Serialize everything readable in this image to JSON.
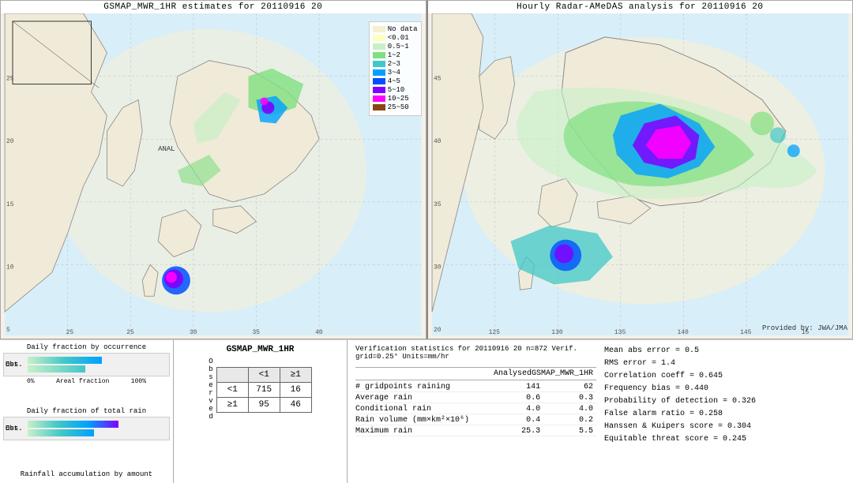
{
  "left_map": {
    "title": "GSMAP_MWR_1HR estimates for 20110916 20",
    "label_anal": "ANAL"
  },
  "right_map": {
    "title": "Hourly Radar-AMeDAS analysis for 20110916 20",
    "provided_by": "Provided by: JWA/JMA"
  },
  "legend": {
    "title": "",
    "items": [
      {
        "label": "No data",
        "color": "#f5f0d0"
      },
      {
        "label": "<0.01",
        "color": "#ffffc0"
      },
      {
        "label": "0.5~1",
        "color": "#c8f0c8"
      },
      {
        "label": "1~2",
        "color": "#80e080"
      },
      {
        "label": "2~3",
        "color": "#40c8c8"
      },
      {
        "label": "3~4",
        "color": "#00a0ff"
      },
      {
        "label": "4~5",
        "color": "#0050ff"
      },
      {
        "label": "5~10",
        "color": "#8000ff"
      },
      {
        "label": "10~25",
        "color": "#ff00ff"
      },
      {
        "label": "25~50",
        "color": "#8b4513"
      }
    ]
  },
  "charts": {
    "occurrence_title": "Daily fraction by occurrence",
    "rain_title": "Daily fraction of total rain",
    "accumulation_title": "Rainfall accumulation by amount",
    "est_label": "Est.",
    "obs_label": "Obs.",
    "x_start": "0%",
    "x_end": "100%",
    "x_mid": "Areal fraction"
  },
  "contingency": {
    "product_title": "GSMAP_MWR_1HR",
    "col_lt1": "<1",
    "col_ge1": "≥1",
    "row_lt1": "<1",
    "row_ge1": "≥1",
    "observed_label": "O\nb\ns\ne\nr\nv\ne\nd",
    "val_lt1_lt1": "715",
    "val_lt1_ge1": "16",
    "val_ge1_lt1": "95",
    "val_ge1_ge1": "46"
  },
  "verification": {
    "header": "Verification statistics for 20110916 20  n=872  Verif. grid=0.25°  Units=mm/hr",
    "col_analysed": "Analysed",
    "col_product": "GSMAP_MWR_1HR",
    "rows": [
      {
        "label": "# gridpoints raining",
        "analysed": "141",
        "product": "62"
      },
      {
        "label": "Average rain",
        "analysed": "0.6",
        "product": "0.3"
      },
      {
        "label": "Conditional rain",
        "analysed": "4.0",
        "product": "4.0"
      },
      {
        "label": "Rain volume (mm×km²×10⁶)",
        "analysed": "0.4",
        "product": "0.2"
      },
      {
        "label": "Maximum rain",
        "analysed": "25.3",
        "product": "5.5"
      }
    ],
    "stats_right": [
      "Mean abs error = 0.5",
      "RMS error = 1.4",
      "Correlation coeff = 0.645",
      "Frequency bias = 0.440",
      "Probability of detection = 0.326",
      "False alarm ratio = 0.258",
      "Hanssen & Kuipers score = 0.304",
      "Equitable threat score = 0.245"
    ]
  }
}
